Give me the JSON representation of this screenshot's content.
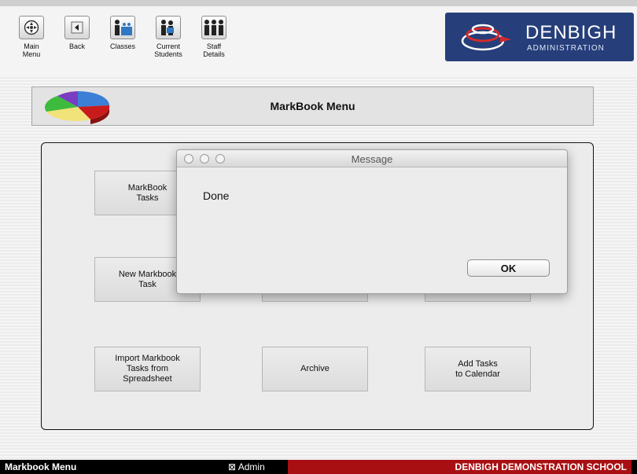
{
  "toolbar": {
    "items": [
      {
        "label": "Main\nMenu",
        "icon": "main-menu-icon"
      },
      {
        "label": "Back",
        "icon": "back-arrow-icon"
      },
      {
        "label": "Classes",
        "icon": "classes-icon"
      },
      {
        "label": "Current\nStudents",
        "icon": "students-icon"
      },
      {
        "label": "Staff\nDetails",
        "icon": "staff-icon"
      }
    ]
  },
  "logo": {
    "name": "DENBIGH",
    "sub": "ADMINISTRATION",
    "color": "#263e7a"
  },
  "page": {
    "title": "MarkBook Menu"
  },
  "menu": {
    "buttons": [
      "MarkBook\nTasks",
      "New Markbook\nTask",
      "Import Markbook\nTasks from\nSpreadsheet",
      "Archive",
      "Add Tasks\nto Calendar"
    ]
  },
  "dialog": {
    "title": "Message",
    "message": "Done",
    "ok": "OK"
  },
  "status": {
    "left": "Markbook Menu",
    "admin": "⊠ Admin",
    "school": "DENBIGH DEMONSTRATION SCHOOL",
    "school_color": "#a80f13"
  }
}
